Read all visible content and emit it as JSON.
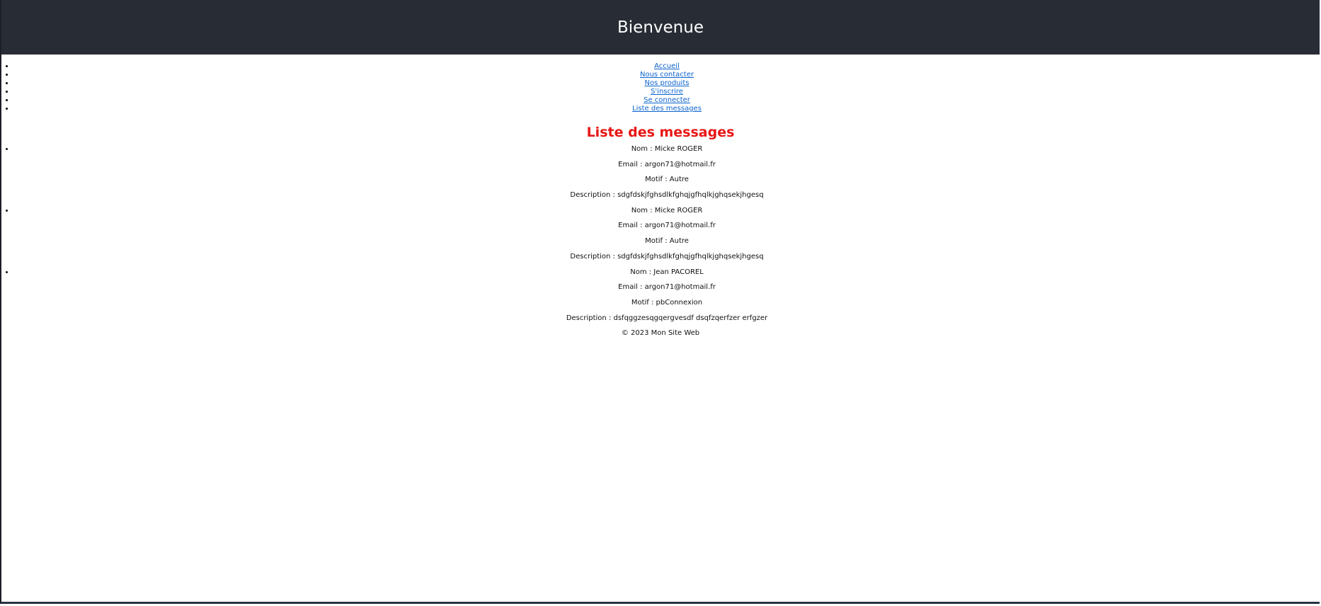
{
  "header": {
    "title": "Bienvenue"
  },
  "nav": {
    "items": [
      {
        "label": "Accueil"
      },
      {
        "label": "Nous contacter"
      },
      {
        "label": "Nos produits"
      },
      {
        "label": "S'inscrire"
      },
      {
        "label": "Se connecter"
      },
      {
        "label": "Liste des messages"
      }
    ]
  },
  "main": {
    "title": "Liste des messages",
    "messages": [
      {
        "nom": "Nom : Micke ROGER",
        "email": "Email : argon71@hotmail.fr",
        "motif": "Motif : Autre",
        "description": "Description : sdgfdskjfghsdlkfghqjgfhqlkjghqsekjhgesq"
      },
      {
        "nom": "Nom : Micke ROGER",
        "email": "Email : argon71@hotmail.fr",
        "motif": "Motif : Autre",
        "description": "Description : sdgfdskjfghsdlkfghqjgfhqlkjghqsekjhgesq"
      },
      {
        "nom": "Nom : Jean PACOREL",
        "email": "Email : argon71@hotmail.fr",
        "motif": "Motif : pbConnexion",
        "description": "Description : dsfqggzesqgqergvesdf dsqfzqerfzer erfgzer"
      }
    ]
  },
  "footer": {
    "text": "© 2023 Mon Site Web"
  },
  "colors": {
    "header_bg": "#282c34",
    "title_red": "#e81616",
    "link_blue": "#0b63ce"
  }
}
